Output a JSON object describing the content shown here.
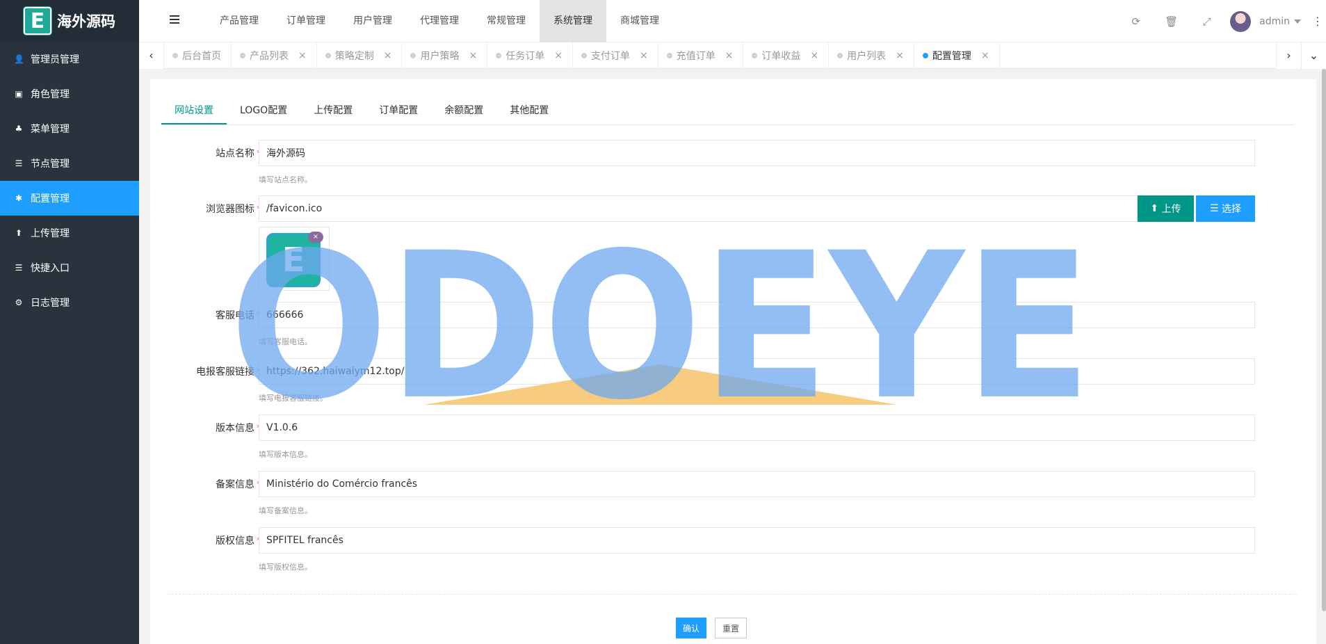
{
  "app": {
    "logo_letter": "E",
    "title": "海外源码"
  },
  "sidebar": {
    "items": [
      {
        "label": "管理员管理",
        "icon": "user-icon",
        "glyph": "👤"
      },
      {
        "label": "角色管理",
        "icon": "role-icon",
        "glyph": "▣"
      },
      {
        "label": "菜单管理",
        "icon": "tree-icon",
        "glyph": "♣"
      },
      {
        "label": "节点管理",
        "icon": "list-icon",
        "glyph": "☰"
      },
      {
        "label": "配置管理",
        "icon": "gear-icon",
        "glyph": "✱",
        "active": true
      },
      {
        "label": "上传管理",
        "icon": "upload-arrow-icon",
        "glyph": "⬆"
      },
      {
        "label": "快捷入口",
        "icon": "list-icon",
        "glyph": "☰"
      },
      {
        "label": "日志管理",
        "icon": "settings-cog-icon",
        "glyph": "⚙"
      }
    ]
  },
  "topnav": {
    "items": [
      "产品管理",
      "订单管理",
      "用户管理",
      "代理管理",
      "常规管理",
      "系统管理",
      "商城管理"
    ],
    "active": "系统管理"
  },
  "header": {
    "user": "admin"
  },
  "tabs": {
    "items": [
      {
        "label": "后台首页",
        "closable": false
      },
      {
        "label": "产品列表",
        "closable": true
      },
      {
        "label": "策略定制",
        "closable": true
      },
      {
        "label": "用户策略",
        "closable": true
      },
      {
        "label": "任务订单",
        "closable": true
      },
      {
        "label": "支付订单",
        "closable": true
      },
      {
        "label": "充值订单",
        "closable": true
      },
      {
        "label": "订单收益",
        "closable": true
      },
      {
        "label": "用户列表",
        "closable": true
      },
      {
        "label": "配置管理",
        "closable": true,
        "active": true
      }
    ]
  },
  "subtabs": {
    "items": [
      "网站设置",
      "LOGO配置",
      "上传配置",
      "订单配置",
      "余额配置",
      "其他配置"
    ],
    "active": "网站设置"
  },
  "form": {
    "site_name": {
      "label": "站点名称",
      "value": "海外源码",
      "tip": "填写站点名称。"
    },
    "favicon": {
      "label": "浏览器图标",
      "value": "/favicon.ico",
      "upload_label": "上传",
      "select_label": "选择",
      "delete_label": "×",
      "logo_letter": "E"
    },
    "service_phone": {
      "label": "客服电话",
      "value": "666666",
      "tip": "填写客服电话。"
    },
    "telegram_link": {
      "label": "电报客服链接",
      "value": "https://362.haiwaiym12.top/",
      "tip": "填写电报客服链接。"
    },
    "version": {
      "label": "版本信息",
      "value": "V1.0.6",
      "tip": "填写版本信息。"
    },
    "record": {
      "label": "备案信息",
      "value": "Ministério do Comércio francês",
      "tip": "填写备案信息。"
    },
    "copyright": {
      "label": "版权信息",
      "value": "SPFITEL francês",
      "tip": "填写版权信息。"
    },
    "required_mark": "*"
  },
  "actions": {
    "confirm": "确认",
    "reset": "重置"
  },
  "watermark": {
    "text": "ODOEYE",
    "color": "#7aaef0",
    "accent": "#f7c36a"
  },
  "colors": {
    "sidebar_bg": "#28333e",
    "primary": "#1e9fff",
    "success": "#009688"
  }
}
